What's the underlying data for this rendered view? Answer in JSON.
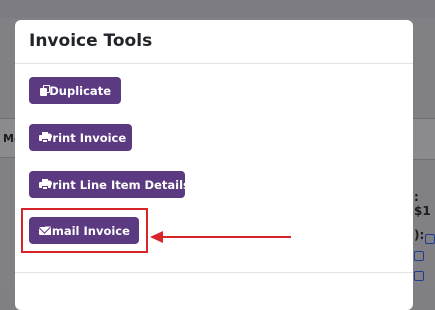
{
  "modal": {
    "title": "Invoice Tools",
    "buttons": {
      "duplicate": {
        "label": "Duplicate",
        "icon": "copy-icon"
      },
      "print_invoice": {
        "label": "Print Invoice",
        "icon": "printer-icon"
      },
      "print_line_items": {
        "label": "Print Line Item Details",
        "icon": "printer-icon"
      },
      "email_invoice": {
        "label": "Email Invoice",
        "icon": "envelope-icon"
      }
    }
  },
  "background": {
    "tab_partial_label": "Me",
    "right_partial_text_1": ": $1",
    "right_partial_text_2": "):"
  },
  "colors": {
    "button_bg": "#5b3a82",
    "annotation": "#d8252a",
    "overlay": "#808085"
  }
}
